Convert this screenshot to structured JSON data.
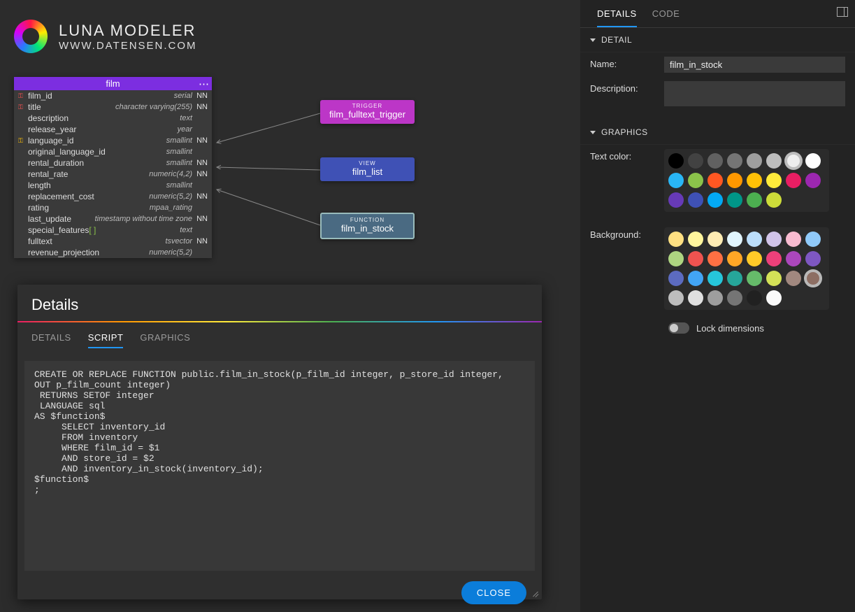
{
  "app": {
    "title": "LUNA MODELER",
    "url": "WWW.DATENSEN.COM"
  },
  "entity": {
    "name": "film",
    "columns": [
      {
        "key": "pk",
        "name": "film_id",
        "type": "serial",
        "nn": "NN"
      },
      {
        "key": "pk",
        "name": "title",
        "type": "character varying(255)",
        "nn": "NN"
      },
      {
        "key": "",
        "name": "description",
        "type": "text",
        "nn": ""
      },
      {
        "key": "",
        "name": "release_year",
        "type": "year",
        "nn": ""
      },
      {
        "key": "fk",
        "name": "language_id",
        "type": "smallint",
        "nn": "NN"
      },
      {
        "key": "",
        "name": "original_language_id",
        "type": "smallint",
        "nn": ""
      },
      {
        "key": "",
        "name": "rental_duration",
        "type": "smallint",
        "nn": "NN"
      },
      {
        "key": "",
        "name": "rental_rate",
        "type": "numeric(4,2)",
        "nn": "NN"
      },
      {
        "key": "",
        "name": "length",
        "type": "smallint",
        "nn": ""
      },
      {
        "key": "",
        "name": "replacement_cost",
        "type": "numeric(5,2)",
        "nn": "NN"
      },
      {
        "key": "",
        "name": "rating",
        "type": "mpaa_rating",
        "nn": ""
      },
      {
        "key": "",
        "name": "last_update",
        "type": "timestamp without time zone",
        "nn": "NN"
      },
      {
        "key": "arr",
        "name": "special_features",
        "type": "text",
        "nn": "",
        "array": "[ ]"
      },
      {
        "key": "",
        "name": "fulltext",
        "type": "tsvector",
        "nn": "NN"
      },
      {
        "key": "",
        "name": "revenue_projection",
        "type": "numeric(5,2)",
        "nn": ""
      }
    ]
  },
  "badges": {
    "trigger": {
      "kind": "TRIGGER",
      "label": "film_fulltext_trigger"
    },
    "view": {
      "kind": "VIEW",
      "label": "film_list"
    },
    "function": {
      "kind": "FUNCTION",
      "label": "film_in_stock"
    }
  },
  "details_panel": {
    "title": "Details",
    "tabs": {
      "details": "DETAILS",
      "script": "SCRIPT",
      "graphics": "GRAPHICS"
    },
    "script": "CREATE OR REPLACE FUNCTION public.film_in_stock(p_film_id integer, p_store_id integer, OUT p_film_count integer)\n RETURNS SETOF integer\n LANGUAGE sql\nAS $function$\n     SELECT inventory_id\n     FROM inventory\n     WHERE film_id = $1\n     AND store_id = $2\n     AND inventory_in_stock(inventory_id);\n$function$\n;",
    "close": "CLOSE"
  },
  "sidebar": {
    "tabs": {
      "details": "DETAILS",
      "code": "CODE"
    },
    "detail_section": "DETAIL",
    "name_label": "Name:",
    "name_value": "film_in_stock",
    "description_label": "Description:",
    "graphics_section": "GRAPHICS",
    "text_color_label": "Text color:",
    "background_label": "Background:",
    "lock_label": "Lock dimensions",
    "text_colors": [
      "#000000",
      "#424242",
      "#616161",
      "#757575",
      "#9e9e9e",
      "#bdbdbd",
      "#eeeeee",
      "#ffffff",
      "#29b6f6",
      "#8bc34a",
      "#ff5722",
      "#ff9800",
      "#ffc107",
      "#ffeb3b",
      "#e91e63",
      "#9c27b0",
      "#673ab7",
      "#3f51b5",
      "#03a9f4",
      "#009688",
      "#4caf50",
      "#cddc39"
    ],
    "text_color_selected": 6,
    "bg_colors": [
      "#ffe082",
      "#fff59d",
      "#ffecb3",
      "#e1f5fe",
      "#bbdefb",
      "#d1c4e9",
      "#f8bbd0",
      "#90caf9",
      "#aed581",
      "#ef5350",
      "#ff7043",
      "#ffa726",
      "#ffca28",
      "#ec407a",
      "#ab47bc",
      "#7e57c2",
      "#5c6bc0",
      "#42a5f5",
      "#26c6da",
      "#26a69a",
      "#66bb6a",
      "#d4e157",
      "#a1887f",
      "#8d6e63",
      "#bdbdbd",
      "#e0e0e0",
      "#9e9e9e",
      "#757575",
      "#212121",
      "#fafafa"
    ],
    "bg_color_selected": 23
  }
}
